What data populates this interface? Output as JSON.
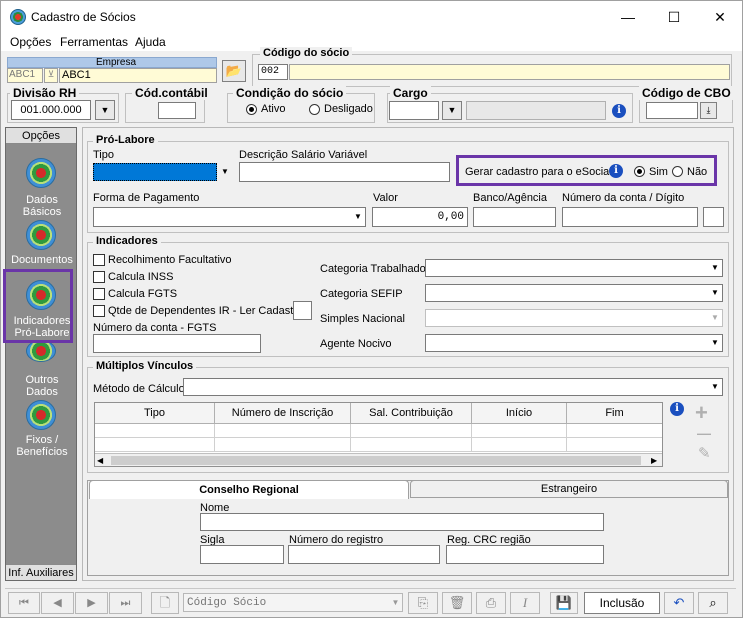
{
  "window": {
    "title": "Cadastro de Sócios",
    "minimize": "—",
    "maximize": "☐",
    "close": "✕"
  },
  "menu": [
    {
      "label": "Opções",
      "accel": "O"
    },
    {
      "label": "Ferramentas",
      "accel": "F"
    },
    {
      "label": "Ajuda",
      "accel": "A"
    }
  ],
  "empresa": {
    "label": "Empresa",
    "code": "ABC1",
    "name": "ABC1"
  },
  "codigo_socio": {
    "label": "Código do sócio",
    "value": "002"
  },
  "divisao_rh": {
    "label": "Divisão RH",
    "value": "001.000.000"
  },
  "cod_contabil": {
    "label": "Cód.contábil",
    "value": ""
  },
  "condicao_socio": {
    "label": "Condição do sócio",
    "options": [
      "Ativo",
      "Desligado"
    ],
    "selected": "Ativo"
  },
  "cargo": {
    "label": "Cargo",
    "value": ""
  },
  "codigo_cbo": {
    "label": "Código de CBO",
    "value": ""
  },
  "sidebar": {
    "title": "Opções",
    "items": [
      {
        "label_1": "Dados",
        "label_2": "Básicos"
      },
      {
        "label_1": "Documentos",
        "label_2": ""
      },
      {
        "label_1": "Indicadores",
        "label_2": "Pró-Labore"
      },
      {
        "label_1": "Outros",
        "label_2": "Dados"
      },
      {
        "label_1": "Fixos /",
        "label_2": "Benefícios"
      }
    ],
    "footer": "Inf. Auxiliares"
  },
  "pro_labore": {
    "title": "Pró-Labore",
    "tipo_label": "Tipo",
    "descricao_label": "Descrição Salário Variável",
    "esocial_label": "Gerar cadastro para o eSocial:",
    "esocial_options": [
      "Sim",
      "Não"
    ],
    "esocial_selected": "Sim",
    "forma_pagamento_label": "Forma de Pagamento",
    "valor_label": "Valor",
    "valor": "0,00",
    "banco_label": "Banco/Agência",
    "conta_label": "Número da conta / Dígito"
  },
  "indicadores": {
    "title": "Indicadores",
    "checkboxes": [
      "Recolhimento Facultativo",
      "Calcula INSS",
      "Calcula FGTS",
      "Qtde de Dependentes IR - Ler Cadastro"
    ],
    "conta_fgts_label": "Número da conta - FGTS",
    "categorias": [
      "Categoria Trabalhador",
      "Categoria SEFIP",
      "Simples Nacional",
      "Agente Nocivo"
    ]
  },
  "multiplos_vinculos": {
    "title": "Múltiplos Vínculos",
    "metodo_label": "Método de Cálculo",
    "columns": [
      "Tipo",
      "Número de Inscrição",
      "Sal. Contribuição",
      "Início",
      "Fim"
    ],
    "add": "+",
    "remove": "—",
    "edit": "✎"
  },
  "tabs": {
    "items": [
      "Conselho Regional",
      "Estrangeiro"
    ],
    "active": "Conselho Regional",
    "nome_label": "Nome",
    "sigla_label": "Sigla",
    "registro_label": "Número do registro",
    "crc_label": "Reg. CRC região"
  },
  "toolbar": {
    "search_placeholder": "Código Sócio",
    "mode": "Inclusão",
    "first": "⏮",
    "prev": "◀",
    "next": "▶",
    "last": "⏭"
  },
  "colors": {
    "highlight": "#6a35a8",
    "selection": "#0078d7",
    "empresa_bg": "#fffbd6",
    "empresa_header": "#aec8e8"
  }
}
